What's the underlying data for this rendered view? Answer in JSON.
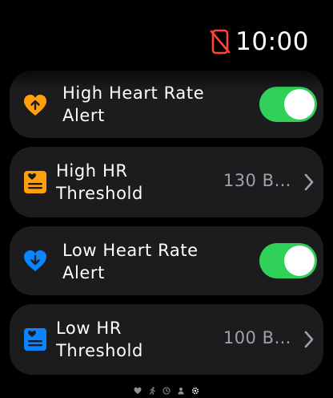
{
  "status": {
    "time": "10:00",
    "disconnected_icon": "phone-disconnected-icon",
    "disconnected_color": "#ff453a"
  },
  "rows": [
    {
      "label": "High Heart Rate Alert",
      "label_line1": "High Heart Rate",
      "label_line2": "Alert",
      "icon": "heart-arrow-up-icon",
      "icon_color": "#ff9f0a",
      "toggle_on": true
    },
    {
      "label": "High HR Threshold",
      "label_line1": "High HR",
      "label_line2": "Threshold",
      "value": "130 B…",
      "icon": "heart-document-icon",
      "icon_color": "#ff9f0a"
    },
    {
      "label": "Low Heart Rate Alert",
      "label_line1": "Low Heart Rate",
      "label_line2": "Alert",
      "icon": "heart-arrow-down-icon",
      "icon_color": "#0a84ff",
      "toggle_on": true
    },
    {
      "label": "Low HR Threshold",
      "label_line1": "Low HR",
      "label_line2": "Threshold",
      "value": "100 B…",
      "icon": "heart-document-icon",
      "icon_color": "#0a84ff"
    }
  ],
  "page_indicator": {
    "pages": [
      "heart-icon",
      "run-icon",
      "clock-icon",
      "person-icon",
      "gear-icon"
    ],
    "current": 4
  },
  "colors": {
    "toggle_on": "#30d158",
    "card": "#1c1c1e",
    "value_text": "#a0a0a8"
  }
}
